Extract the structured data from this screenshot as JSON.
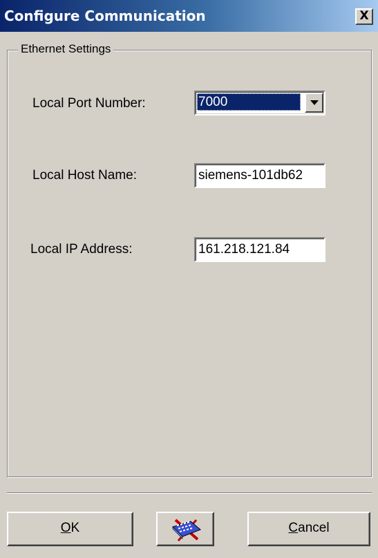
{
  "window": {
    "title": "Configure Communication",
    "close_label": "X"
  },
  "group": {
    "legend": "Ethernet Settings"
  },
  "fields": {
    "port": {
      "label": "Local Port Number:",
      "value": "7000"
    },
    "host": {
      "label": "Local Host Name:",
      "value": "siemens-101db62"
    },
    "ip": {
      "label": "Local IP Address:",
      "value": "161.218.121.84"
    }
  },
  "buttons": {
    "ok": {
      "mnemonic": "O",
      "rest": "K"
    },
    "keyboard": {
      "icon": "keyboard-icon"
    },
    "cancel": {
      "mnemonic": "C",
      "rest": "ancel"
    }
  },
  "colors": {
    "title_bar_start": "#0a246a",
    "title_bar_end": "#a6caf0",
    "selection": "#0a246a",
    "face": "#d4d0c8"
  }
}
